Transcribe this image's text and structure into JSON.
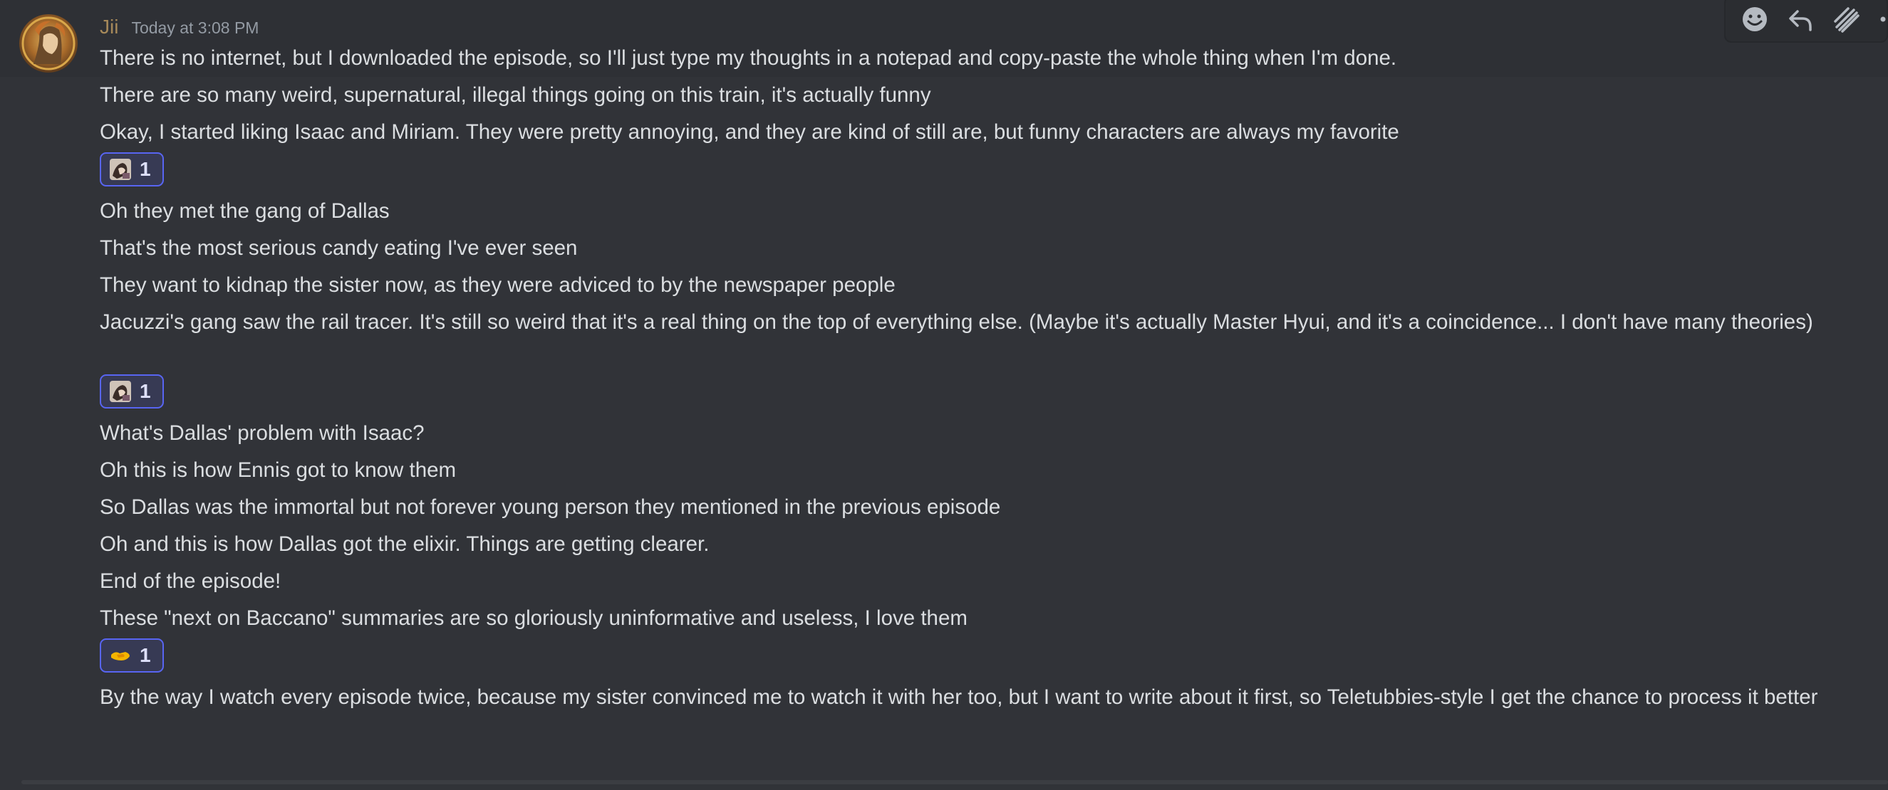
{
  "message": {
    "author": "Jii",
    "timestamp": "Today at 3:08 PM",
    "lines": [
      "There is no internet, but I downloaded the episode, so I'll just type my thoughts in a notepad and copy-paste the whole thing when I'm done.",
      "There are so many weird, supernatural, illegal things going on this train, it's actually funny",
      "Okay, I started liking Isaac and Miriam. They were pretty annoying, and they are kind of still are, but funny characters are always my favorite",
      "Oh they met the gang of Dallas",
      "That's the most serious candy eating I've ever seen",
      "They want to kidnap the sister now, as they were adviced to by the newspaper people",
      "Jacuzzi's gang saw the rail tracer. It's still so weird that it's a real thing on the top of everything else. (Maybe it's actually Master Hyui, and it's a coincidence... I don't have many theories)",
      "What's Dallas' problem with Isaac?",
      "Oh this is how Ennis got to know them",
      "So Dallas was the immortal but not forever young person they mentioned in the previous episode",
      "Oh and this is how Dallas got the elixir. Things are getting clearer.",
      "End of the episode!",
      "These \"next on Baccano\" summaries are so gloriously uninformative and useless, I love them",
      "By the way I watch every episode twice, because my sister convinced me to watch it with her too, but I want to write about it first, so Teletubbies-style I get the chance to process it better"
    ],
    "reactions": [
      {
        "emoji": "custom-emoji-character",
        "count": "1"
      },
      {
        "emoji": "custom-emoji-character",
        "count": "1"
      },
      {
        "emoji": "handshake-emoji",
        "count": "1"
      }
    ]
  },
  "toolbar": {
    "icons": [
      "add-reaction-icon",
      "reply-icon",
      "create-thread-icon",
      "more-options-icon"
    ]
  },
  "colors": {
    "background": "#313338",
    "username": "#a6895a",
    "reaction_border": "#5865f2",
    "text": "#dbdee1"
  }
}
